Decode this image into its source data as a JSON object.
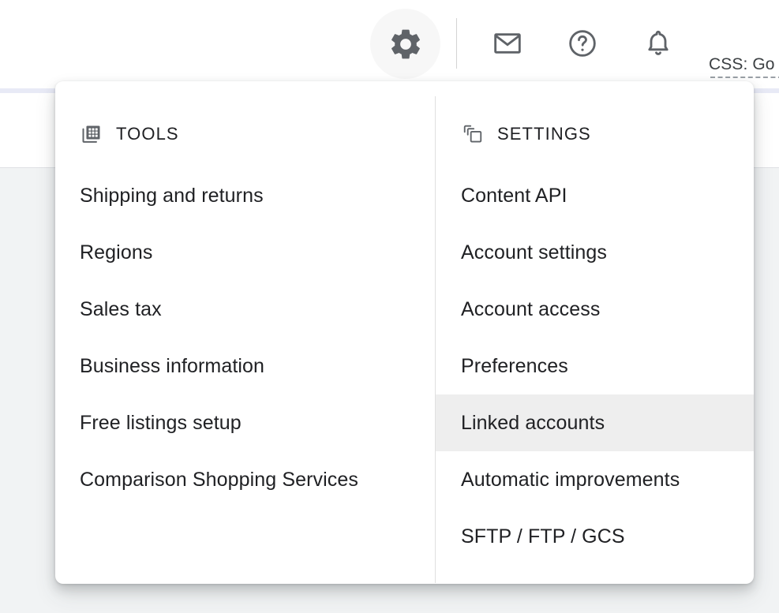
{
  "header": {
    "gear_icon": "gear-icon",
    "icons": [
      {
        "name": "mail-icon",
        "label": "Messages"
      },
      {
        "name": "help-icon",
        "label": "Help"
      },
      {
        "name": "bell-icon",
        "label": "Notifications"
      }
    ],
    "css_label": "CSS: Go"
  },
  "menu": {
    "columns": [
      {
        "id": "tools",
        "icon": "grid-copy-icon",
        "title": "TOOLS",
        "items": [
          {
            "label": "Shipping and returns",
            "highlighted": false
          },
          {
            "label": "Regions",
            "highlighted": false
          },
          {
            "label": "Sales tax",
            "highlighted": false
          },
          {
            "label": "Business information",
            "highlighted": false
          },
          {
            "label": "Free listings setup",
            "highlighted": false
          },
          {
            "label": "Comparison Shopping Services",
            "highlighted": false
          }
        ]
      },
      {
        "id": "settings",
        "icon": "layers-icon",
        "title": "SETTINGS",
        "items": [
          {
            "label": "Content API",
            "highlighted": false
          },
          {
            "label": "Account settings",
            "highlighted": false
          },
          {
            "label": "Account access",
            "highlighted": false
          },
          {
            "label": "Preferences",
            "highlighted": false
          },
          {
            "label": "Linked accounts",
            "highlighted": true
          },
          {
            "label": "Automatic improvements",
            "highlighted": false
          },
          {
            "label": "SFTP / FTP / GCS",
            "highlighted": false
          }
        ]
      }
    ]
  },
  "colors": {
    "icon_gray": "#5f6368",
    "text_primary": "#202124",
    "highlight": "#eeeeee",
    "page_accent": "#e8eaf6",
    "page_body": "#f1f3f4"
  }
}
